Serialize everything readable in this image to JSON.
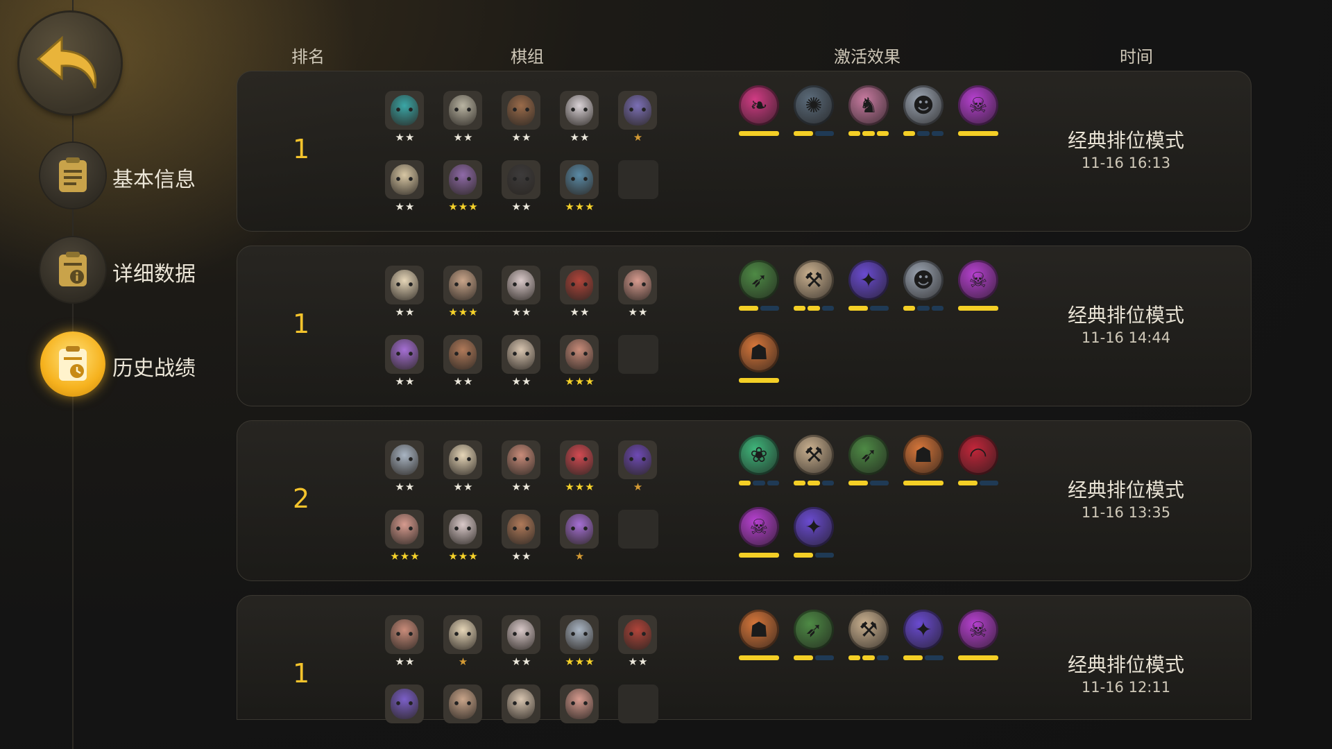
{
  "sidebar": {
    "back_icon": "back-arrow-icon",
    "items": [
      {
        "label": "基本信息",
        "icon": "document-icon",
        "active": false
      },
      {
        "label": "详细数据",
        "icon": "info-document-icon",
        "active": false
      },
      {
        "label": "历史战绩",
        "icon": "clock-document-icon",
        "active": true
      }
    ]
  },
  "headers": {
    "rank": "排名",
    "lineup": "棋组",
    "traits": "激活效果",
    "time": "时间"
  },
  "colors": {
    "accent": "#f3c32c",
    "star_gold": "#f6d22a",
    "star_white": "#ece8dc",
    "star_bronze": "#d49a34",
    "bar_on": "#f4cf26",
    "bar_off": "#1f3a55"
  },
  "matches": [
    {
      "rank": "1",
      "mode": "经典排位模式",
      "time": "11-16 16:13",
      "pieces": [
        {
          "name": "armored-knight",
          "stars": "★★",
          "color": "#3aa6a6"
        },
        {
          "name": "robot-golem",
          "stars": "★★",
          "color": "#b9b4a2"
        },
        {
          "name": "warrior-long-hair",
          "stars": "★★",
          "color": "#9a6b4a"
        },
        {
          "name": "white-haired-mage",
          "stars": "★★",
          "color": "#d9d2d6"
        },
        {
          "name": "bat-demon",
          "stars": "★",
          "color": "#7b6fb5"
        },
        {
          "name": "horned-skull",
          "stars": "★★",
          "color": "#d8c7a4"
        },
        {
          "name": "green-alien",
          "stars": "★★★",
          "color": "#8f6aa8"
        },
        {
          "name": "dark-elf",
          "stars": "★★",
          "color": "#3d3b3b"
        },
        {
          "name": "red-eye-brute",
          "stars": "★★★",
          "color": "#5a8aa6"
        }
      ],
      "traits": [
        {
          "name": "dragon-trait-icon",
          "glyph": "❧",
          "color": "#d13b84",
          "level": 3,
          "max": 1
        },
        {
          "name": "gear-trait-icon",
          "glyph": "✺",
          "color": "#5b6b7a",
          "level": 1,
          "max": 2
        },
        {
          "name": "knight-trait-icon",
          "glyph": "♞",
          "color": "#c77aa0",
          "level": 3,
          "max": 3
        },
        {
          "name": "pilot-trait-icon",
          "glyph": "☻",
          "color": "#9aa3b0",
          "level": 1,
          "max": 3
        },
        {
          "name": "demon-trait-icon",
          "glyph": "☠",
          "color": "#b640d0",
          "level": 1,
          "max": 1
        }
      ]
    },
    {
      "rank": "1",
      "mode": "经典排位模式",
      "time": "11-16 14:44",
      "pieces": [
        {
          "name": "white-beard-elder",
          "stars": "★★",
          "color": "#e6d6b8"
        },
        {
          "name": "old-warrior",
          "stars": "★★★",
          "color": "#c9a58a"
        },
        {
          "name": "goblin-grump",
          "stars": "★★",
          "color": "#d9c9c9"
        },
        {
          "name": "pirate-captain",
          "stars": "★★",
          "color": "#b0443a"
        },
        {
          "name": "horned-mask",
          "stars": "★★",
          "color": "#d79b8f"
        },
        {
          "name": "purple-witch",
          "stars": "★★",
          "color": "#a56fd4"
        },
        {
          "name": "goggle-bruiser",
          "stars": "★★",
          "color": "#b07a5a"
        },
        {
          "name": "scar-face",
          "stars": "★★",
          "color": "#d8c5b0"
        },
        {
          "name": "goggle-dwarf",
          "stars": "★★★",
          "color": "#c98c7a"
        }
      ],
      "traits": [
        {
          "name": "bow-trait-icon",
          "glyph": "➶",
          "color": "#4e8a45",
          "level": 1,
          "max": 2
        },
        {
          "name": "axe-trait-icon",
          "glyph": "⚒",
          "color": "#c9b08f",
          "level": 2,
          "max": 3
        },
        {
          "name": "fish-trait-icon",
          "glyph": "✦",
          "color": "#6a4bd0",
          "level": 1,
          "max": 2
        },
        {
          "name": "pilot-trait-icon",
          "glyph": "☻",
          "color": "#9aa3b0",
          "level": 1,
          "max": 3
        },
        {
          "name": "demon-trait-icon",
          "glyph": "☠",
          "color": "#b640d0",
          "level": 1,
          "max": 1
        },
        {
          "name": "viking-trait-icon",
          "glyph": "☗",
          "color": "#d6763a",
          "level": 1,
          "max": 1
        }
      ]
    },
    {
      "rank": "2",
      "mode": "经典排位模式",
      "time": "11-16 13:35",
      "pieces": [
        {
          "name": "grey-goblin",
          "stars": "★★",
          "color": "#a9b5c3"
        },
        {
          "name": "white-beard-elder",
          "stars": "★★",
          "color": "#e6d6b8"
        },
        {
          "name": "goggle-dwarf",
          "stars": "★★",
          "color": "#c98c7a"
        },
        {
          "name": "red-ogre",
          "stars": "★★★",
          "color": "#d24a52"
        },
        {
          "name": "horned-dark-mage",
          "stars": "★",
          "color": "#6e4ab5"
        },
        {
          "name": "horned-mask",
          "stars": "★★★",
          "color": "#d79b8f"
        },
        {
          "name": "goblin-grump",
          "stars": "★★★",
          "color": "#d9c9c9"
        },
        {
          "name": "goggle-bruiser",
          "stars": "★★",
          "color": "#b07a5a"
        },
        {
          "name": "purple-witch",
          "stars": "★",
          "color": "#a56fd4"
        }
      ],
      "traits": [
        {
          "name": "paw-trait-icon",
          "glyph": "❀",
          "color": "#3fb57a",
          "level": 1,
          "max": 3
        },
        {
          "name": "axe-trait-icon",
          "glyph": "⚒",
          "color": "#c9b08f",
          "level": 2,
          "max": 3
        },
        {
          "name": "bow-trait-icon",
          "glyph": "➶",
          "color": "#4e8a45",
          "level": 1,
          "max": 2
        },
        {
          "name": "viking-trait-icon",
          "glyph": "☗",
          "color": "#d6763a",
          "level": 1,
          "max": 1
        },
        {
          "name": "arch-trait-icon",
          "glyph": "◠",
          "color": "#c2263a",
          "level": 1,
          "max": 2
        },
        {
          "name": "demon-trait-icon",
          "glyph": "☠",
          "color": "#b640d0",
          "level": 1,
          "max": 1
        },
        {
          "name": "fish-trait-icon",
          "glyph": "✦",
          "color": "#6a4bd0",
          "level": 1,
          "max": 2
        }
      ]
    },
    {
      "rank": "1",
      "mode": "经典排位模式",
      "time": "11-16 12:11",
      "pieces": [
        {
          "name": "goggle-dwarf",
          "stars": "★★",
          "color": "#c98c7a"
        },
        {
          "name": "white-beard-elder",
          "stars": "★",
          "color": "#e6d6b8"
        },
        {
          "name": "goblin-grump",
          "stars": "★★",
          "color": "#d9c9c9"
        },
        {
          "name": "grey-goblin",
          "stars": "★★★",
          "color": "#a9b5c3"
        },
        {
          "name": "pirate-captain",
          "stars": "★★",
          "color": "#b0443a"
        },
        {
          "name": "purple-golem",
          "stars": "",
          "color": "#7b5fc8"
        },
        {
          "name": "old-warrior",
          "stars": "",
          "color": "#c9a58a"
        },
        {
          "name": "scar-face",
          "stars": "",
          "color": "#d8c5b0"
        },
        {
          "name": "horned-mask",
          "stars": "",
          "color": "#d79b8f"
        }
      ],
      "traits": [
        {
          "name": "viking-trait-icon",
          "glyph": "☗",
          "color": "#d6763a",
          "level": 1,
          "max": 1
        },
        {
          "name": "bow-trait-icon",
          "glyph": "➶",
          "color": "#4e8a45",
          "level": 1,
          "max": 2
        },
        {
          "name": "axe-trait-icon",
          "glyph": "⚒",
          "color": "#c9b08f",
          "level": 2,
          "max": 3
        },
        {
          "name": "fish-trait-icon",
          "glyph": "✦",
          "color": "#6a4bd0",
          "level": 1,
          "max": 2
        },
        {
          "name": "demon-trait-icon",
          "glyph": "☠",
          "color": "#b640d0",
          "level": 1,
          "max": 1
        }
      ]
    }
  ]
}
